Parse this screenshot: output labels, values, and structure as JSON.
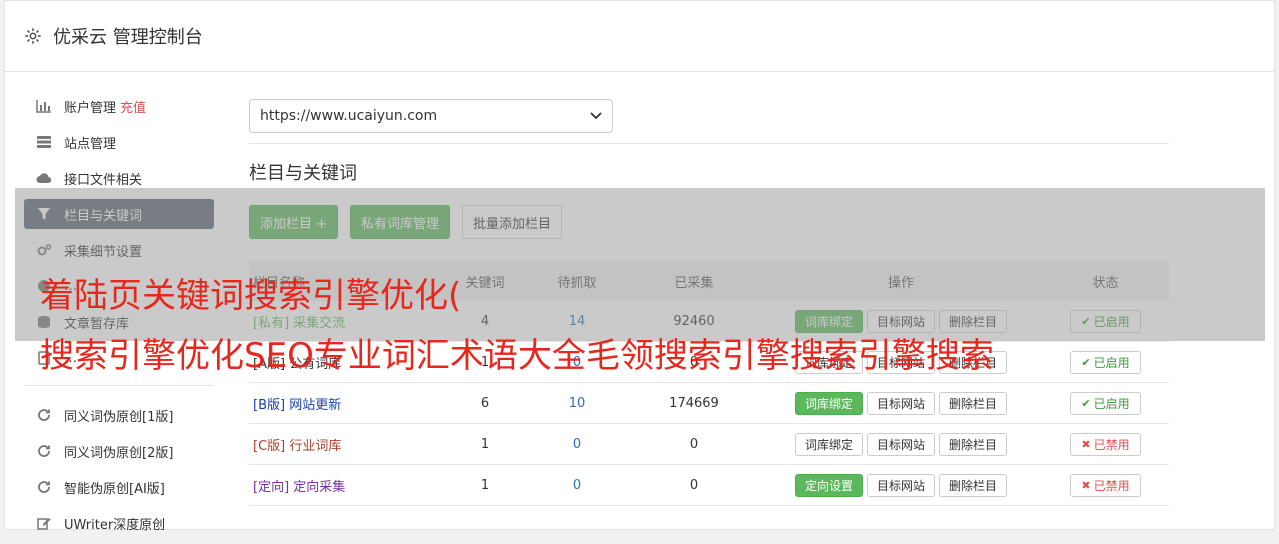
{
  "header": {
    "title": "优采云 管理控制台",
    "icon": "gear-icon"
  },
  "sidebar": {
    "items": [
      {
        "label": "账户管理",
        "extra": "充值",
        "icon": "bar-chart-icon"
      },
      {
        "label": "站点管理",
        "icon": "server-icon"
      },
      {
        "label": "接口文件相关",
        "icon": "cloud-upload-icon"
      },
      {
        "label": "栏目与关键词",
        "icon": "filter-icon",
        "active": true
      },
      {
        "label": "采集细节设置",
        "icon": "gears-icon"
      },
      {
        "label": "…",
        "icon": "circle-icon"
      },
      {
        "label": "文章暂存库",
        "icon": "database-icon"
      },
      {
        "label": "…",
        "icon": "file-icon"
      }
    ],
    "items2": [
      {
        "label": "同义词伪原创[1版]",
        "icon": "refresh-icon"
      },
      {
        "label": "同义词伪原创[2版]",
        "icon": "refresh-icon"
      },
      {
        "label": "智能伪原创[AI版]",
        "icon": "refresh-icon"
      },
      {
        "label": "UWriter深度原创",
        "icon": "edit-icon"
      }
    ]
  },
  "main": {
    "site_select": "https://www.ucaiyun.com",
    "section_title": "栏目与关键词",
    "buttons": {
      "add_column": "添加栏目 +",
      "private_lib": "私有词库管理",
      "batch_add": "批量添加栏目"
    },
    "table": {
      "headers": {
        "name": "栏目名称",
        "kw": "关键词",
        "pending": "待抓取",
        "collected": "已采集",
        "ops": "操作",
        "status": "状态"
      },
      "rows": [
        {
          "tag": "[私有]",
          "name": "采集交流",
          "kw": "4",
          "pending": "14",
          "collected": "92460",
          "op1": "词库绑定",
          "op1_green": true,
          "op2": "目标网站",
          "op3": "删除栏目",
          "status": "已启用",
          "on": true,
          "tagclass": "tag-private"
        },
        {
          "tag": "[A版]",
          "name": "公有词库",
          "kw": "1",
          "pending": "0",
          "collected": "0",
          "op1": "词库绑定",
          "op1_green": false,
          "op2": "目标网站",
          "op3": "删除栏目",
          "status": "已启用",
          "on": true,
          "tagclass": "tag-a"
        },
        {
          "tag": "[B版]",
          "name": "网站更新",
          "kw": "6",
          "pending": "10",
          "collected": "174669",
          "op1": "词库绑定",
          "op1_green": true,
          "op2": "目标网站",
          "op3": "删除栏目",
          "status": "已启用",
          "on": true,
          "tagclass": "tag-b"
        },
        {
          "tag": "[C版]",
          "name": "行业词库",
          "kw": "1",
          "pending": "0",
          "collected": "0",
          "op1": "词库绑定",
          "op1_green": false,
          "op2": "目标网站",
          "op3": "删除栏目",
          "status": "已禁用",
          "on": false,
          "tagclass": "tag-c"
        },
        {
          "tag": "[定向]",
          "name": "定向采集",
          "kw": "1",
          "pending": "0",
          "collected": "0",
          "op1": "定向设置",
          "op1_green": true,
          "op2": "目标网站",
          "op3": "删除栏目",
          "status": "已禁用",
          "on": false,
          "tagclass": "tag-d"
        }
      ]
    }
  },
  "overlay": {
    "line1": "着陆页关键词搜索引擎优化(",
    "line2": "搜索引擎优化SEO专业词汇术语大全毛领搜索引擎搜索引擎搜索"
  },
  "colors": {
    "accent_green": "#5cb85c",
    "active_nav": "#5a6470",
    "ad_red": "#e8261c"
  }
}
